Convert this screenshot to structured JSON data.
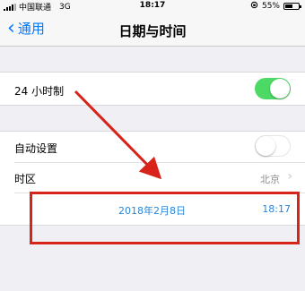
{
  "status_bar": {
    "carrier": "中国联通",
    "network": "3G",
    "time": "18:17",
    "battery": "55%",
    "battery_level": 0.55
  },
  "nav": {
    "back_label": "通用",
    "title": "日期与时间"
  },
  "settings": {
    "hour24": {
      "label": "24 小时制",
      "enabled": true
    },
    "auto_set": {
      "label": "自动设置",
      "enabled": false
    },
    "timezone": {
      "label": "时区",
      "value": "北京"
    }
  },
  "picker": {
    "date": "2018年2月8日",
    "time": "18:17"
  },
  "colors": {
    "accent": "#007aff",
    "toggle_on": "#4cd964",
    "annotation": "#d8231a"
  }
}
